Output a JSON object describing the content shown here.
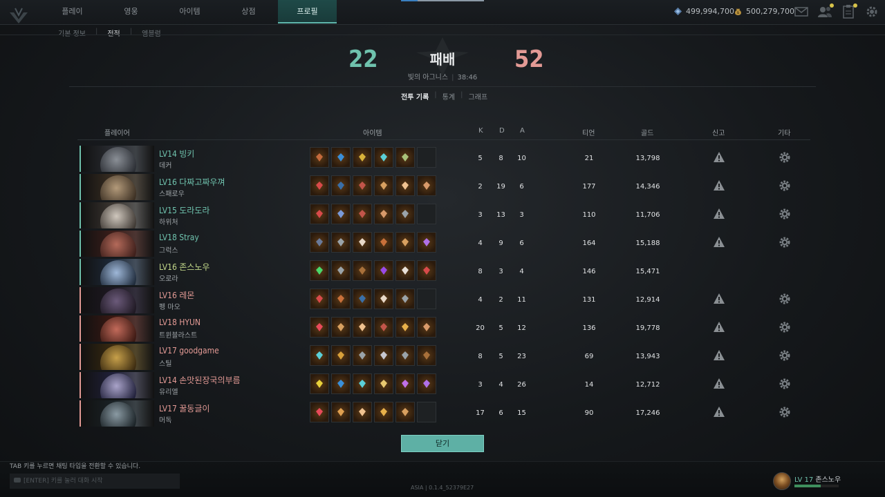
{
  "nav": {
    "tabs": [
      "플레이",
      "영웅",
      "아이템",
      "상점",
      "프로필"
    ],
    "active": "프로필",
    "currency_blue": "499,994,700",
    "currency_gold": "500,279,700"
  },
  "subnav": {
    "items": [
      "기본 정보",
      "전적",
      "엠블럼"
    ],
    "active": "전적"
  },
  "match": {
    "score_left": "22",
    "score_right": "52",
    "result": "패배",
    "map": "빛의 아그니스",
    "duration": "38:46"
  },
  "view_tabs": [
    "전투 기록",
    "통계",
    "그래프"
  ],
  "columns": {
    "player": "플레이어",
    "items": "아이템",
    "k": "K",
    "d": "D",
    "a": "A",
    "tier": "티언",
    "gold": "골드",
    "report": "신고",
    "etc": "기타"
  },
  "colors": {
    "team_ally": "#6fc2ad",
    "team_enemy": "#e39a95",
    "self": "#c3d98a",
    "accent": "#5eb0a5"
  },
  "players": [
    {
      "level": "LV14",
      "name": "빙키",
      "hero": "데커",
      "k": "5",
      "d": "8",
      "a": "10",
      "tier": "21",
      "gold": "13,798",
      "team": "ally",
      "items": [
        "feather",
        "ring",
        "gold",
        "blade",
        "claw",
        ""
      ],
      "report": true,
      "gear": true
    },
    {
      "level": "LV16",
      "name": "다짜고짜우껴",
      "hero": "스패로우",
      "k": "2",
      "d": "19",
      "a": "6",
      "tier": "177",
      "gold": "14,346",
      "team": "ally",
      "items": [
        "shard",
        "spear",
        "mask",
        "sword",
        "egg",
        "knife"
      ],
      "report": true,
      "gear": true
    },
    {
      "level": "LV15",
      "name": "도라도라",
      "hero": "하위처",
      "k": "3",
      "d": "13",
      "a": "3",
      "tier": "110",
      "gold": "11,706",
      "team": "ally",
      "items": [
        "shard",
        "eye",
        "mask",
        "knife",
        "armor",
        ""
      ],
      "report": true,
      "gear": true
    },
    {
      "level": "LV18",
      "name": "Stray",
      "hero": "그럭스",
      "k": "4",
      "d": "9",
      "a": "6",
      "tier": "164",
      "gold": "15,188",
      "team": "ally",
      "items": [
        "cube",
        "armor",
        "wing",
        "bow",
        "sword",
        "crystal"
      ],
      "report": true,
      "gear": true
    },
    {
      "level": "LV16",
      "name": "존스노우",
      "hero": "오로라",
      "k": "8",
      "d": "3",
      "a": "4",
      "tier": "146",
      "gold": "15,471",
      "team": "self",
      "items": [
        "gem",
        "armor",
        "idol",
        "orb",
        "claws",
        "arc"
      ],
      "report": false,
      "gear": false
    },
    {
      "level": "LV16",
      "name": "레몬",
      "hero": "펭 마오",
      "k": "4",
      "d": "2",
      "a": "11",
      "tier": "131",
      "gold": "12,914",
      "team": "enemy",
      "items": [
        "shard",
        "bow",
        "spear",
        "wing",
        "armor",
        ""
      ],
      "report": true,
      "gear": true
    },
    {
      "level": "LV18",
      "name": "HYUN",
      "hero": "트윈블라스트",
      "k": "20",
      "d": "5",
      "a": "12",
      "tier": "136",
      "gold": "19,778",
      "team": "enemy",
      "items": [
        "ruby",
        "sword",
        "egg",
        "mask",
        "potion",
        "knife"
      ],
      "report": true,
      "gear": true
    },
    {
      "level": "LV17",
      "name": "goodgame",
      "hero": "스틸",
      "k": "8",
      "d": "5",
      "a": "23",
      "tier": "69",
      "gold": "13,943",
      "team": "enemy",
      "items": [
        "blade",
        "golem",
        "armor",
        "wolf",
        "armor",
        "idol"
      ],
      "report": true,
      "gear": true
    },
    {
      "level": "LV14",
      "name": "손맛된장국의부름",
      "hero": "유리엘",
      "k": "3",
      "d": "4",
      "a": "26",
      "tier": "14",
      "gold": "12,712",
      "team": "enemy",
      "items": [
        "topaz",
        "ring",
        "blade",
        "scroll",
        "vial",
        "crystal"
      ],
      "report": true,
      "gear": true
    },
    {
      "level": "LV17",
      "name": "꿀동글이",
      "hero": "머독",
      "k": "17",
      "d": "6",
      "a": "15",
      "tier": "90",
      "gold": "17,246",
      "team": "enemy",
      "items": [
        "ruby",
        "staff",
        "egg",
        "potion",
        "sword",
        ""
      ],
      "report": true,
      "gear": true
    }
  ],
  "close_label": "닫기",
  "chat": {
    "hint": "TAB 키를 누르면 채팅 타입을 전환할 수 있습니다.",
    "placeholder": "[ENTER] 키를 눌러 대화 시작"
  },
  "version": "ASIA  |  0.1.4_52379E27",
  "me": {
    "level": "LV 17",
    "name": "존스노우",
    "xp_fraction": 0.6
  }
}
